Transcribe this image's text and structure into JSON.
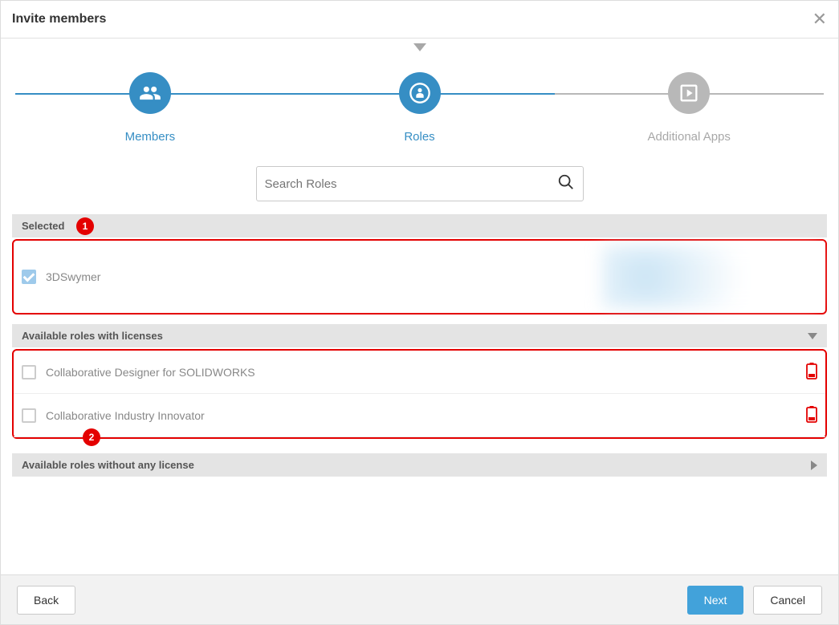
{
  "header": {
    "title": "Invite members"
  },
  "stepper": {
    "steps": [
      {
        "label": "Members",
        "state": "completed"
      },
      {
        "label": "Roles",
        "state": "active"
      },
      {
        "label": "Additional Apps",
        "state": "pending"
      }
    ]
  },
  "search": {
    "placeholder": "Search Roles"
  },
  "sections": {
    "selected": {
      "title": "Selected",
      "callout": "1",
      "items": [
        {
          "label": "3DSwymer",
          "checked": true
        }
      ]
    },
    "available_with_licenses": {
      "title": "Available roles with licenses",
      "callout": "2",
      "items": [
        {
          "label": "Collaborative Designer for SOLIDWORKS",
          "checked": false,
          "low_license": true
        },
        {
          "label": "Collaborative Industry Innovator",
          "checked": false,
          "low_license": true
        }
      ]
    },
    "available_without_license": {
      "title": "Available roles without any license"
    }
  },
  "footer": {
    "back": "Back",
    "next": "Next",
    "cancel": "Cancel"
  }
}
